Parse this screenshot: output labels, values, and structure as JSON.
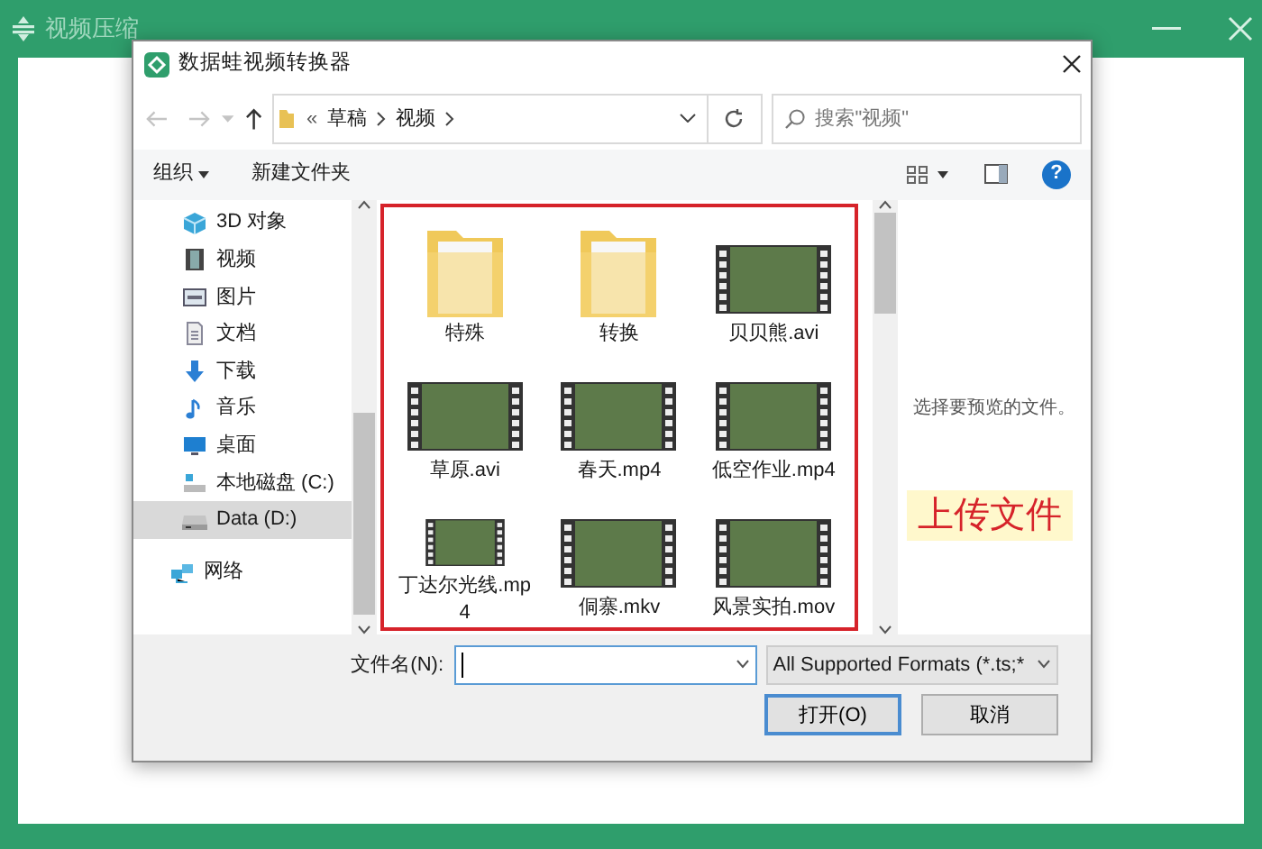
{
  "app": {
    "title": "视频压缩",
    "preview_text": "选择要预览的文件。"
  },
  "dialog": {
    "title": "数据蛙视频转换器",
    "breadcrumb": [
      {
        "text": "«",
        "kind": "overflow"
      },
      {
        "text": "草稿",
        "kind": "folder"
      },
      {
        "text": "视频",
        "kind": "folder"
      }
    ],
    "search": {
      "placeholder": "搜索\"视频\""
    },
    "toolbar": {
      "organize": "组织",
      "new_folder": "新建文件夹",
      "help": "?"
    },
    "sidebar": [
      {
        "label": "3D 对象",
        "kind": "cube",
        "selected": false
      },
      {
        "label": "视频",
        "kind": "film",
        "selected": false
      },
      {
        "label": "图片",
        "kind": "picture",
        "selected": false
      },
      {
        "label": "文档",
        "kind": "document",
        "selected": false
      },
      {
        "label": "下载",
        "kind": "download",
        "selected": false
      },
      {
        "label": "音乐",
        "kind": "music",
        "selected": false
      },
      {
        "label": "桌面",
        "kind": "desktop",
        "selected": false
      },
      {
        "label": "本地磁盘 (C:)",
        "kind": "system-drive",
        "selected": false
      },
      {
        "label": "Data (D:)",
        "kind": "drive",
        "selected": true
      },
      {
        "label": "网络",
        "kind": "network",
        "selected": false
      }
    ],
    "files": [
      {
        "name": "特殊",
        "kind": "folder"
      },
      {
        "name": "转换",
        "kind": "folder"
      },
      {
        "name": "贝贝熊.avi",
        "kind": "video"
      },
      {
        "name": "草原.avi",
        "kind": "video"
      },
      {
        "name": "春天.mp4",
        "kind": "video"
      },
      {
        "name": "低空作业.mp4",
        "kind": "video"
      },
      {
        "name": "丁达尔光线.mp4",
        "kind": "video"
      },
      {
        "name": "侗寨.mkv",
        "kind": "video"
      },
      {
        "name": "风景实拍.mov",
        "kind": "video"
      }
    ],
    "filename_label": "文件名(N):",
    "filter": "All Supported Formats (*.ts;*",
    "buttons": [
      {
        "label": "打开(O)",
        "default": true
      },
      {
        "label": "取消",
        "default": false
      }
    ]
  },
  "annotation": "上传文件"
}
